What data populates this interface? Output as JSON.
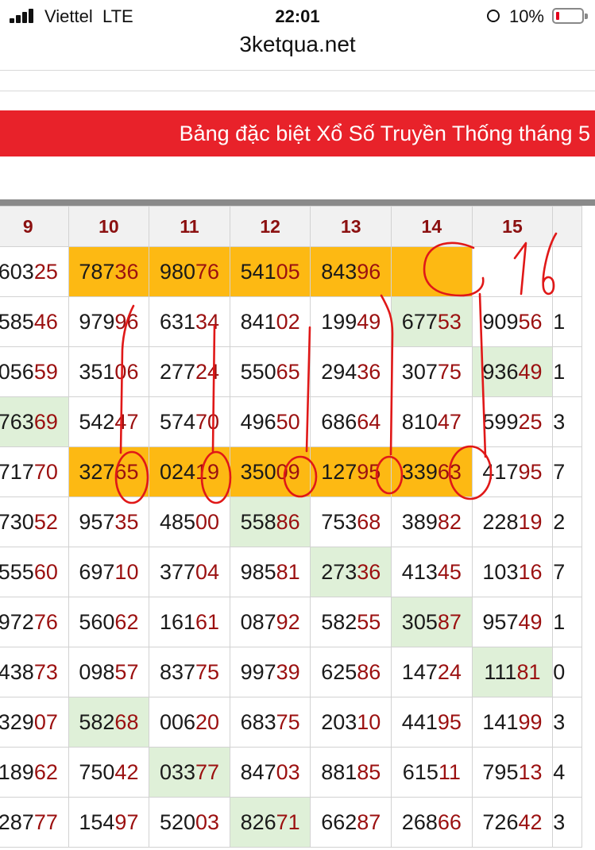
{
  "status_bar": {
    "carrier": "Viettel",
    "network": "LTE",
    "time": "22:01",
    "battery": "10%"
  },
  "browser": {
    "url": "3ketqua.net"
  },
  "banner": {
    "title": "Bảng đặc biệt Xổ Số Truyền Thống tháng 5"
  },
  "table": {
    "days": [
      "9",
      "10",
      "11",
      "12",
      "13",
      "14",
      "15",
      ""
    ],
    "rows": [
      [
        "603",
        "25",
        "787",
        "36",
        "980",
        "76",
        "541",
        "05",
        "843",
        "96",
        "",
        "",
        "",
        "",
        "",
        ""
      ],
      [
        "585",
        "46",
        "979",
        "96",
        "631",
        "34",
        "841",
        "02",
        "199",
        "49",
        "677",
        "53",
        "909",
        "56",
        "1",
        ""
      ],
      [
        "056",
        "59",
        "351",
        "06",
        "277",
        "24",
        "550",
        "65",
        "294",
        "36",
        "307",
        "75",
        "936",
        "49",
        "1",
        ""
      ],
      [
        "763",
        "69",
        "542",
        "47",
        "574",
        "70",
        "496",
        "50",
        "686",
        "64",
        "810",
        "47",
        "599",
        "25",
        "3",
        ""
      ],
      [
        "717",
        "70",
        "327",
        "65",
        "024",
        "19",
        "350",
        "09",
        "127",
        "95",
        "339",
        "63",
        "417",
        "95",
        "7",
        ""
      ],
      [
        "730",
        "52",
        "957",
        "35",
        "485",
        "00",
        "558",
        "86",
        "753",
        "68",
        "389",
        "82",
        "228",
        "19",
        "2",
        ""
      ],
      [
        "555",
        "60",
        "697",
        "10",
        "377",
        "04",
        "985",
        "81",
        "273",
        "36",
        "413",
        "45",
        "103",
        "16",
        "7",
        ""
      ],
      [
        "972",
        "76",
        "560",
        "62",
        "161",
        "61",
        "087",
        "92",
        "582",
        "55",
        "305",
        "87",
        "957",
        "49",
        "1",
        ""
      ],
      [
        "438",
        "73",
        "098",
        "57",
        "837",
        "75",
        "997",
        "39",
        "625",
        "86",
        "147",
        "24",
        "111",
        "81",
        "0",
        ""
      ],
      [
        "329",
        "07",
        "582",
        "68",
        "006",
        "20",
        "683",
        "75",
        "203",
        "10",
        "441",
        "95",
        "141",
        "99",
        "3",
        ""
      ],
      [
        "189",
        "62",
        "750",
        "42",
        "033",
        "77",
        "847",
        "03",
        "881",
        "85",
        "615",
        "11",
        "795",
        "13",
        "4",
        ""
      ],
      [
        "287",
        "77",
        "154",
        "97",
        "520",
        "03",
        "826",
        "71",
        "662",
        "87",
        "268",
        "66",
        "726",
        "42",
        "3",
        ""
      ]
    ],
    "highlight_colors": {
      "yellow": "#fdb913",
      "green": "#dff0d8",
      "banner": "#e8222a"
    }
  },
  "annotation": {
    "text": "16"
  }
}
